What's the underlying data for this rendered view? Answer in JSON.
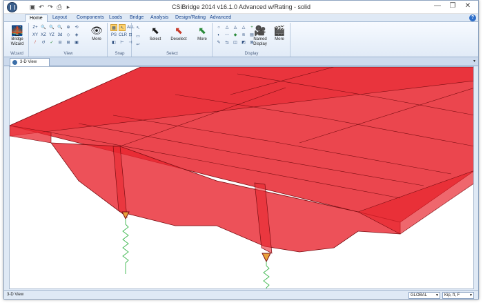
{
  "window": {
    "title": "CSiBridge 2014  v16.1.0 Advanced w/Rating  - solid",
    "controls": {
      "minimize": "—",
      "restore": "❐",
      "close": "✕"
    }
  },
  "quick_access": [
    "save-icon",
    "undo-icon",
    "redo-icon",
    "print-icon",
    "dropdown-icon"
  ],
  "tabs": [
    "Home",
    "Layout",
    "Components",
    "Loads",
    "Bridge",
    "Analysis",
    "Design/Rating",
    "Advanced"
  ],
  "active_tab": "Home",
  "help_label": "?",
  "ribbon": {
    "wizard": {
      "button_label": "Bridge Wizard",
      "group_label": "Wizard"
    },
    "view": {
      "more_label": "More",
      "group_label": "View",
      "icons": [
        "Z+",
        "🔍",
        "🔍",
        "🔍",
        "⊕",
        "⟲",
        "XY",
        "XZ",
        "YZ",
        "3d",
        "◇",
        "◈",
        "/",
        "↺",
        "✓",
        "⊟",
        "⊞",
        "▣"
      ]
    },
    "snap": {
      "group_label": "Snap",
      "icons": [
        "▦",
        "↖",
        "ALL",
        "PS",
        "CLR",
        "⊡",
        "◧",
        "⊢",
        "⊣"
      ]
    },
    "select": {
      "select_label": "Select",
      "deselect_label": "Deselect",
      "more_label": "More",
      "group_label": "Select"
    },
    "display": {
      "named_display_label": "Named Display",
      "more_label": "More",
      "group_label": "Display",
      "icons": [
        "○",
        "△",
        "◬",
        "△",
        "+",
        "◐",
        "⋯",
        "◆",
        "≋",
        "▤",
        "✎",
        "⇆",
        "◫",
        "◩",
        "⊠"
      ]
    }
  },
  "view_tab": {
    "label": "3-D View",
    "arrow": "▾"
  },
  "status": {
    "text": "3-D View",
    "coord_system": "GLOBAL",
    "units": "Kip, ft, F"
  },
  "colors": {
    "deck_fill": "#e8262f",
    "deck_edge": "#7a0d12",
    "spring": "#39b54a",
    "support": "#e8a23c"
  }
}
